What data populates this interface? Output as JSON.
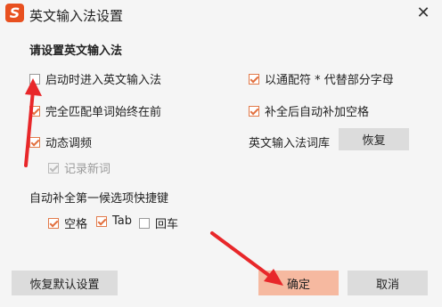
{
  "window": {
    "title": "英文输入法设置",
    "logo_letter": "S"
  },
  "section": {
    "title": "请设置英文输入法"
  },
  "options_left": [
    {
      "label": "启动时进入英文输入法",
      "checked": false
    },
    {
      "label": "完全匹配单词始终在前",
      "checked": true
    },
    {
      "label": "动态调频",
      "checked": true
    },
    {
      "label": "记录新词",
      "checked": true,
      "disabled": true
    }
  ],
  "options_right": [
    {
      "label": "以通配符 * 代替部分字母",
      "checked": true
    },
    {
      "label": "补全后自动补加空格",
      "checked": true
    }
  ],
  "lexicon": {
    "label": "英文输入法词库",
    "button": "恢复"
  },
  "shortcut": {
    "title": "自动补全第一候选项快捷键",
    "options": [
      {
        "label": "空格",
        "checked": true
      },
      {
        "label": "Tab",
        "checked": true
      },
      {
        "label": "回车",
        "checked": false
      }
    ]
  },
  "footer": {
    "restore_defaults": "恢复默认设置",
    "ok": "确定",
    "cancel": "取消"
  },
  "colors": {
    "accent": "#e8501f",
    "ok_button": "#f6b9a0",
    "arrow": "#e8272a"
  }
}
